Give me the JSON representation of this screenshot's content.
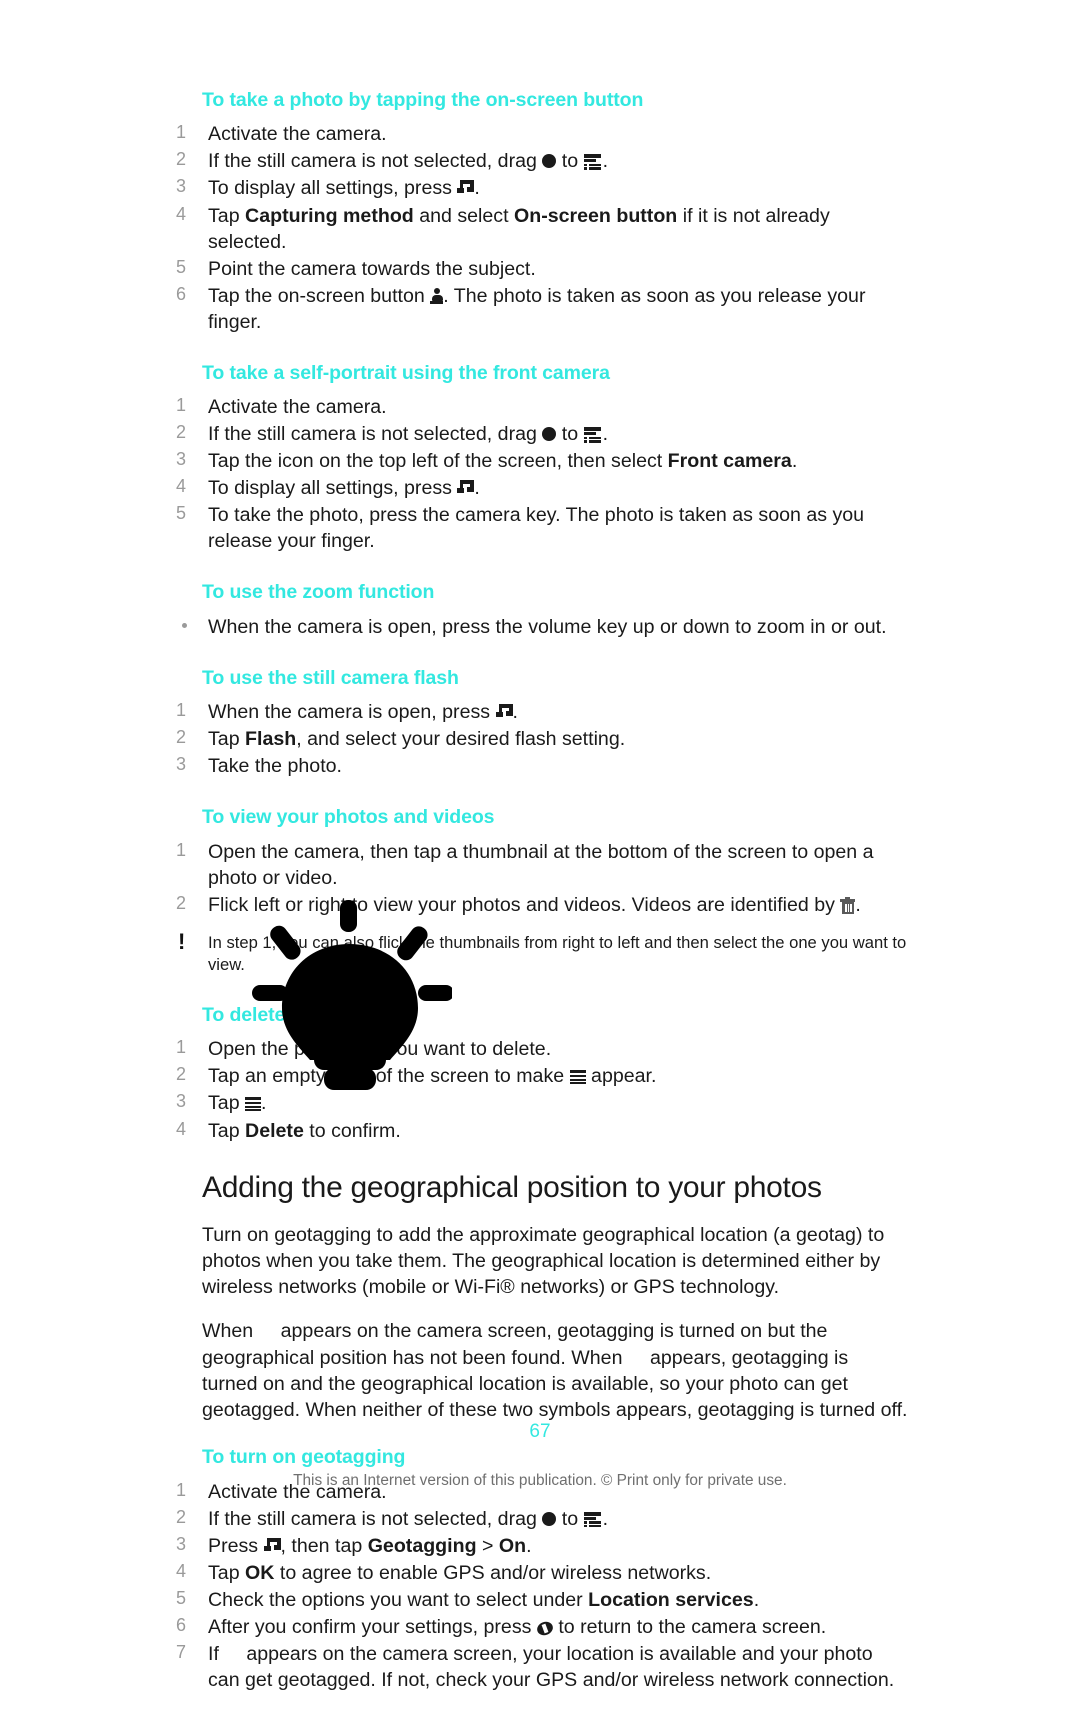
{
  "document": {
    "page_number": "67",
    "footer_note": "This is an Internet version of this publication. © Print only for private use.",
    "accent_color": "#33e8e0",
    "text_color": "#1a1a1a"
  },
  "sections": [
    {
      "id": "tap-onscreen-button",
      "heading": "To take a photo by tapping the on-screen button",
      "list_type": "ordered",
      "steps": [
        {
          "num": "1",
          "parts": [
            {
              "t": "text",
              "v": "Activate the camera."
            }
          ]
        },
        {
          "num": "2",
          "parts": [
            {
              "t": "text",
              "v": "If the still camera is not selected, drag "
            },
            {
              "t": "icon",
              "v": "circle-icon"
            },
            {
              "t": "text",
              "v": " to "
            },
            {
              "t": "icon",
              "v": "still-camera-mode-icon"
            },
            {
              "t": "text",
              "v": "."
            }
          ]
        },
        {
          "num": "3",
          "parts": [
            {
              "t": "text",
              "v": "To display all settings, press "
            },
            {
              "t": "icon",
              "v": "menu-key-icon"
            },
            {
              "t": "text",
              "v": "."
            }
          ]
        },
        {
          "num": "4",
          "parts": [
            {
              "t": "text",
              "v": "Tap "
            },
            {
              "t": "bold",
              "v": "Capturing method"
            },
            {
              "t": "text",
              "v": " and select "
            },
            {
              "t": "bold",
              "v": "On-screen button"
            },
            {
              "t": "text",
              "v": " if it is not already selected."
            }
          ]
        },
        {
          "num": "5",
          "parts": [
            {
              "t": "text",
              "v": "Point the camera towards the subject."
            }
          ]
        },
        {
          "num": "6",
          "parts": [
            {
              "t": "text",
              "v": "Tap the on-screen button "
            },
            {
              "t": "icon",
              "v": "shutter-button-icon"
            },
            {
              "t": "text",
              "v": ". The photo is taken as soon as you release your finger."
            }
          ]
        }
      ]
    },
    {
      "id": "self-portrait-front-camera",
      "heading": "To take a self-portrait using the front camera",
      "list_type": "ordered",
      "steps": [
        {
          "num": "1",
          "parts": [
            {
              "t": "text",
              "v": "Activate the camera."
            }
          ]
        },
        {
          "num": "2",
          "parts": [
            {
              "t": "text",
              "v": "If the still camera is not selected, drag "
            },
            {
              "t": "icon",
              "v": "circle-icon"
            },
            {
              "t": "text",
              "v": " to "
            },
            {
              "t": "icon",
              "v": "still-camera-mode-icon"
            },
            {
              "t": "text",
              "v": "."
            }
          ]
        },
        {
          "num": "3",
          "parts": [
            {
              "t": "text",
              "v": "Tap the icon on the top left of the screen, then select "
            },
            {
              "t": "bold",
              "v": "Front camera"
            },
            {
              "t": "text",
              "v": "."
            }
          ]
        },
        {
          "num": "4",
          "parts": [
            {
              "t": "text",
              "v": "To display all settings, press "
            },
            {
              "t": "icon",
              "v": "menu-key-icon"
            },
            {
              "t": "text",
              "v": "."
            }
          ]
        },
        {
          "num": "5",
          "parts": [
            {
              "t": "text",
              "v": "To take the photo, press the camera key. The photo is taken as soon as you release your finger."
            }
          ]
        }
      ]
    },
    {
      "id": "zoom-function",
      "heading": "To use the zoom function",
      "list_type": "bullet",
      "steps": [
        {
          "num": "",
          "parts": [
            {
              "t": "text",
              "v": "When the camera is open, press the volume key up or down to zoom in or out."
            }
          ]
        }
      ]
    },
    {
      "id": "still-camera-flash",
      "heading": "To use the still camera flash",
      "list_type": "ordered",
      "steps": [
        {
          "num": "1",
          "parts": [
            {
              "t": "text",
              "v": "When the camera is open, press "
            },
            {
              "t": "icon",
              "v": "menu-key-icon"
            },
            {
              "t": "text",
              "v": "."
            }
          ]
        },
        {
          "num": "2",
          "parts": [
            {
              "t": "text",
              "v": "Tap "
            },
            {
              "t": "bold",
              "v": "Flash"
            },
            {
              "t": "text",
              "v": ", and select your desired flash setting."
            }
          ]
        },
        {
          "num": "3",
          "parts": [
            {
              "t": "text",
              "v": "Take the photo."
            }
          ]
        }
      ]
    },
    {
      "id": "view-photos-videos",
      "heading": "To view your photos and videos",
      "list_type": "ordered",
      "steps": [
        {
          "num": "1",
          "parts": [
            {
              "t": "text",
              "v": "Open the camera, then tap a thumbnail at the bottom of the screen to open a photo or video."
            }
          ]
        },
        {
          "num": "2",
          "parts": [
            {
              "t": "text",
              "v": "Flick left or right to view your photos and videos. Videos are identified by "
            },
            {
              "t": "icon",
              "v": "trash-icon"
            },
            {
              "t": "text",
              "v": "."
            }
          ]
        }
      ],
      "note": "In step 1, you can also flick the thumbnails from right to left and then select the one you want to view."
    },
    {
      "id": "delete-a-photo",
      "heading": "To delete a photo",
      "list_type": "ordered",
      "steps": [
        {
          "num": "1",
          "parts": [
            {
              "t": "text",
              "v": "Open the photo that you want to delete."
            }
          ]
        },
        {
          "num": "2",
          "parts": [
            {
              "t": "text",
              "v": "Tap an empty area of the screen to make "
            },
            {
              "t": "icon",
              "v": "hamburger-menu-icon"
            },
            {
              "t": "text",
              "v": " appear."
            }
          ]
        },
        {
          "num": "3",
          "parts": [
            {
              "t": "text",
              "v": "Tap "
            },
            {
              "t": "icon",
              "v": "hamburger-menu-icon"
            },
            {
              "t": "text",
              "v": "."
            }
          ]
        },
        {
          "num": "4",
          "parts": [
            {
              "t": "text",
              "v": "Tap "
            },
            {
              "t": "bold",
              "v": "Delete"
            },
            {
              "t": "text",
              "v": " to confirm."
            }
          ]
        }
      ]
    }
  ],
  "chapter": {
    "title": "Adding the geographical position to your photos",
    "paragraphs": [
      {
        "id": "geotag-intro",
        "parts": [
          {
            "t": "text",
            "v": "Turn on geotagging to add the approximate geographical location (a geotag) to photos when you take them. The geographical location is determined either by wireless networks (mobile or Wi-Fi® networks) or GPS technology."
          }
        ]
      },
      {
        "id": "geotag-symbols",
        "parts": [
          {
            "t": "text",
            "v": "When "
          },
          {
            "t": "gap",
            "v": "missing-glyph"
          },
          {
            "t": "text",
            "v": "appears on the camera screen, geotagging is turned on but the geographical position has not been found. When "
          },
          {
            "t": "gap",
            "v": "missing-glyph"
          },
          {
            "t": "text",
            "v": "appears, geotagging is turned on and the geographical location is available, so your photo can get geotagged. When neither of these two symbols appears, geotagging is turned off."
          }
        ]
      }
    ]
  },
  "geotagging_section": {
    "id": "turn-on-geotagging",
    "heading": "To turn on geotagging",
    "steps": [
      {
        "num": "1",
        "parts": [
          {
            "t": "text",
            "v": "Activate the camera."
          }
        ]
      },
      {
        "num": "2",
        "parts": [
          {
            "t": "text",
            "v": "If the still camera is not selected, drag "
          },
          {
            "t": "icon",
            "v": "circle-icon"
          },
          {
            "t": "text",
            "v": " to "
          },
          {
            "t": "icon",
            "v": "still-camera-mode-icon"
          },
          {
            "t": "text",
            "v": "."
          }
        ]
      },
      {
        "num": "3",
        "parts": [
          {
            "t": "text",
            "v": "Press "
          },
          {
            "t": "icon",
            "v": "menu-key-icon"
          },
          {
            "t": "text",
            "v": ", then tap "
          },
          {
            "t": "bold",
            "v": "Geotagging"
          },
          {
            "t": "text",
            "v": " > "
          },
          {
            "t": "bold",
            "v": "On"
          },
          {
            "t": "text",
            "v": "."
          }
        ]
      },
      {
        "num": "4",
        "parts": [
          {
            "t": "text",
            "v": "Tap "
          },
          {
            "t": "bold",
            "v": "OK"
          },
          {
            "t": "text",
            "v": " to agree to enable GPS and/or wireless networks."
          }
        ]
      },
      {
        "num": "5",
        "parts": [
          {
            "t": "text",
            "v": "Check the options you want to select under "
          },
          {
            "t": "bold",
            "v": "Location services"
          },
          {
            "t": "text",
            "v": "."
          }
        ]
      },
      {
        "num": "6",
        "parts": [
          {
            "t": "text",
            "v": "After you confirm your settings, press "
          },
          {
            "t": "icon",
            "v": "back-key-icon"
          },
          {
            "t": "text",
            "v": " to return to the camera screen."
          }
        ]
      },
      {
        "num": "7",
        "parts": [
          {
            "t": "text",
            "v": "If "
          },
          {
            "t": "gap",
            "v": "missing-glyph"
          },
          {
            "t": "text",
            "v": "appears on the camera screen, your location is available and your photo can get geotagged. If not, check your GPS and/or wireless network connection."
          }
        ]
      }
    ]
  },
  "decorations": {
    "lightbulb": "lightbulb-watermark"
  }
}
